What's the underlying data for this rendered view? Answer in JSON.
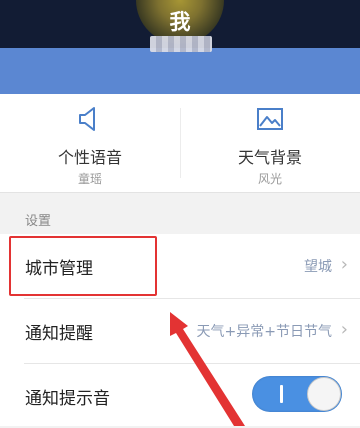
{
  "header": {
    "title": "我"
  },
  "features": [
    {
      "label": "个性语音",
      "sub": "童瑶",
      "icon": "speaker-icon"
    },
    {
      "label": "天气背景",
      "sub": "风光",
      "icon": "image-icon"
    }
  ],
  "settings": {
    "section_title": "设置",
    "rows": [
      {
        "label": "城市管理",
        "value": "望城"
      },
      {
        "label": "通知提醒",
        "value": "天气+异常+节日节气"
      },
      {
        "label": "通知提示音",
        "toggle": true
      }
    ]
  },
  "colors": {
    "accent": "#4a90e2",
    "header_blue": "#5b87d2",
    "annotation_red": "#e33333"
  }
}
